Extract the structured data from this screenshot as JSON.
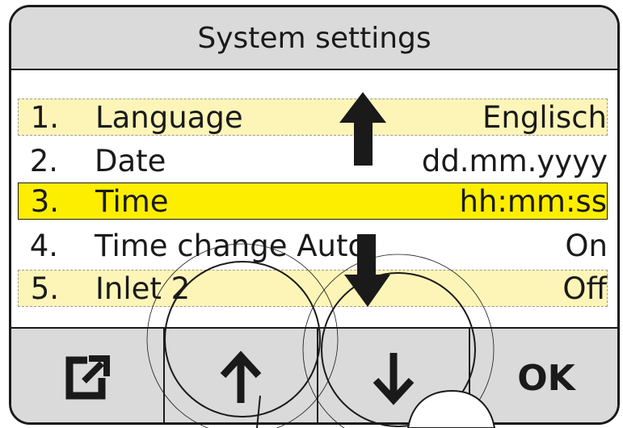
{
  "header": {
    "title": "System settings"
  },
  "menu": {
    "items": [
      {
        "num": "1.",
        "label": "Language",
        "value": "Englisch",
        "state": "dim"
      },
      {
        "num": "2.",
        "label": "Date",
        "value": "dd.mm.yyyy",
        "state": "normal"
      },
      {
        "num": "3.",
        "label": "Time",
        "value": "hh:mm:ss",
        "state": "selected"
      },
      {
        "num": "4.",
        "label": "Time change Auto",
        "value": "On",
        "state": "normal"
      },
      {
        "num": "5.",
        "label": "Inlet 2",
        "value": "Off",
        "state": "dim"
      }
    ]
  },
  "softkeys": {
    "exit_icon": "exit-icon",
    "up_icon": "arrow-up-icon",
    "down_icon": "arrow-down-icon",
    "ok_label": "OK"
  },
  "colors": {
    "header_bg": "#dadada",
    "selected_row": "#fdee00",
    "dim_row": "#fdf5b8",
    "outline": "#1a1a1a"
  }
}
